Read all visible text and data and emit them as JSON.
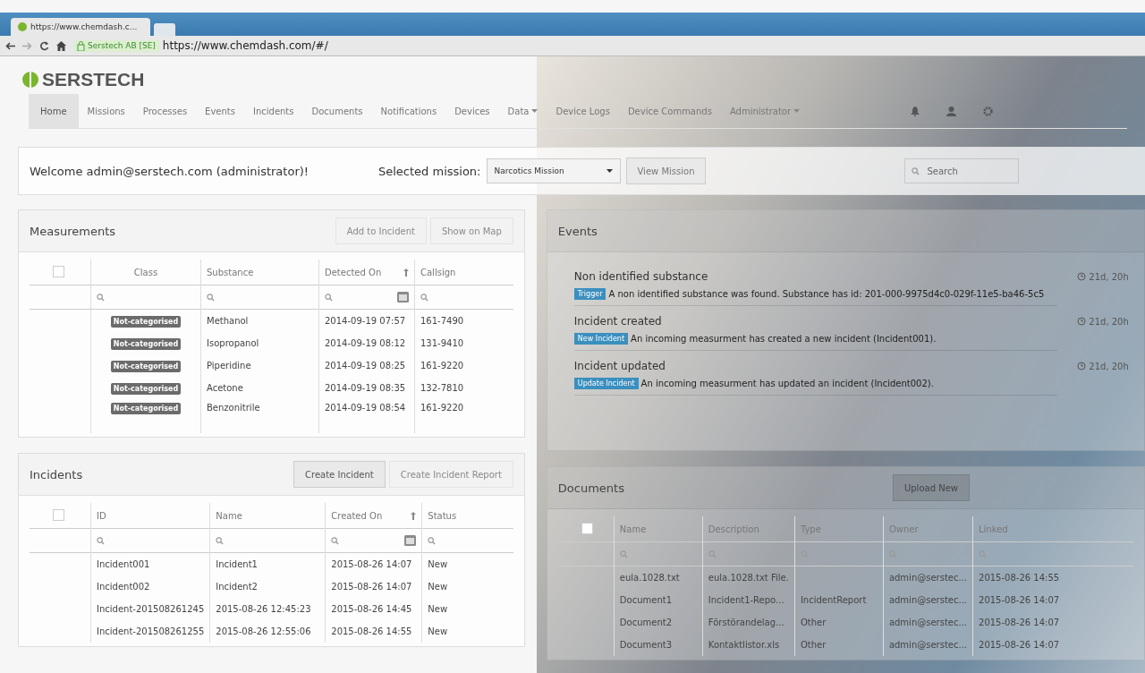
{
  "browser": {
    "tab_title": "https://www.chemdash.c...",
    "certificate": "Serstech AB [SE]",
    "url": "https://www.chemdash.com/#/"
  },
  "brand": "SERSTECH",
  "nav": [
    {
      "label": "Home",
      "selected": true,
      "dropdown": false
    },
    {
      "label": "Missions",
      "selected": false,
      "dropdown": false
    },
    {
      "label": "Processes",
      "selected": false,
      "dropdown": false
    },
    {
      "label": "Events",
      "selected": false,
      "dropdown": false
    },
    {
      "label": "Incidents",
      "selected": false,
      "dropdown": false
    },
    {
      "label": "Documents",
      "selected": false,
      "dropdown": false
    },
    {
      "label": "Notifications",
      "selected": false,
      "dropdown": false
    },
    {
      "label": "Devices",
      "selected": false,
      "dropdown": false
    },
    {
      "label": "Data",
      "selected": false,
      "dropdown": true
    },
    {
      "label": "Device Logs",
      "selected": false,
      "dropdown": false
    },
    {
      "label": "Device Commands",
      "selected": false,
      "dropdown": false
    },
    {
      "label": "Administrator",
      "selected": false,
      "dropdown": true
    }
  ],
  "welcome": {
    "text": "Welcome admin@serstech.com (administrator)!",
    "mission_label": "Selected mission:",
    "mission_value": "Narcotics Mission",
    "view_button": "View Mission",
    "search_placeholder": "Search"
  },
  "measurements": {
    "title": "Measurements",
    "checked": false,
    "buttons": [
      "Add to Incident",
      "Show on Map"
    ],
    "columns": [
      {
        "label": "Class",
        "sorted": false,
        "date": false
      },
      {
        "label": "Substance",
        "sorted": false,
        "date": false
      },
      {
        "label": "Detected On",
        "sorted": true,
        "date": true
      },
      {
        "label": "Callsign",
        "sorted": false,
        "date": false
      }
    ],
    "rows": [
      [
        "Not-categorised",
        "Methanol",
        "2014-09-19 07:57",
        "161-7490"
      ],
      [
        "Not-categorised",
        "Isopropanol",
        "2014-09-19 08:12",
        "131-9410"
      ],
      [
        "Not-categorised",
        "Piperidine",
        "2014-09-19 08:25",
        "161-9220"
      ],
      [
        "Not-categorised",
        "Acetone",
        "2014-09-19 08:35",
        "132-7810"
      ],
      [
        "Not-categorised",
        "Benzonitrile",
        "2014-09-19 08:54",
        "161-9220"
      ]
    ]
  },
  "events": {
    "title": "Events",
    "items": [
      {
        "title": "Non identified substance",
        "tag": "Trigger",
        "text": "A non identified substance was found. Substance has id: 201-000-9975d4c0-029f-11e5-ba46-5c5",
        "time": "21d, 20h"
      },
      {
        "title": "Incident created",
        "tag": "New Incident",
        "text": "An incoming measurment has created a new incident (Incident001).",
        "time": "21d, 20h"
      },
      {
        "title": "Incident updated",
        "tag": "Update Incident",
        "text": "An incoming measurment has updated an incident (Incident002).",
        "time": "21d, 20h"
      }
    ]
  },
  "incidents": {
    "title": "Incidents",
    "checked": false,
    "buttons": [
      {
        "label": "Create Incident",
        "disabled": false
      },
      {
        "label": "Create Incident Report",
        "disabled": true
      }
    ],
    "columns": [
      {
        "label": "ID",
        "sorted": false,
        "date": false
      },
      {
        "label": "Name",
        "sorted": false,
        "date": false
      },
      {
        "label": "Created On",
        "sorted": true,
        "date": true
      },
      {
        "label": "Status",
        "sorted": false,
        "date": false
      }
    ],
    "rows": [
      [
        "Incident001",
        "Incident1",
        "2015-08-26 14:07",
        "New"
      ],
      [
        "Incident002",
        "Incident2",
        "2015-08-26 14:07",
        "New"
      ],
      [
        "Incident-201508261245",
        "2015-08-26 12:45:23",
        "2015-08-26 14:45",
        "New"
      ],
      [
        "Incident-201508261255",
        "2015-08-26 12:55:06",
        "2015-08-26 14:55",
        "New"
      ]
    ]
  },
  "documents": {
    "title": "Documents",
    "checked": false,
    "button": "Upload New",
    "columns": [
      {
        "label": "Name",
        "sorted": false,
        "date": false
      },
      {
        "label": "Description",
        "sorted": false,
        "date": false
      },
      {
        "label": "Type",
        "sorted": false,
        "date": false
      },
      {
        "label": "Owner",
        "sorted": false,
        "date": false
      },
      {
        "label": "Linked",
        "sorted": false,
        "date": false
      }
    ],
    "rows": [
      [
        "eula.1028.txt",
        "eula.1028.txt File.",
        "",
        "admin@serstec...",
        "2015-08-26 14:55"
      ],
      [
        "Document1",
        "Incident1-Repo...",
        "IncidentReport",
        "admin@serstec...",
        "2015-08-26 14:07"
      ],
      [
        "Document2",
        "Förstörandelag...",
        "Other",
        "admin@serstec...",
        "2015-08-26 14:07"
      ],
      [
        "Document3",
        "Kontaktlistor.xls",
        "Other",
        "admin@serstec...",
        "2015-08-26 14:07"
      ]
    ]
  }
}
